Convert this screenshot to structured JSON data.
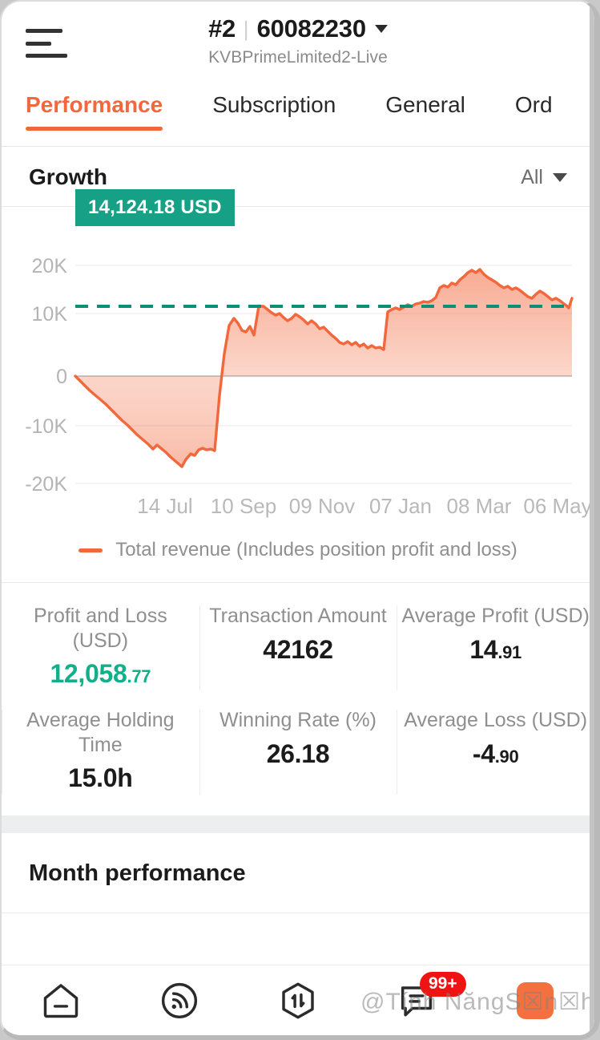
{
  "header": {
    "menu_icon": "hamburger-menu-icon",
    "account_number": "#2",
    "account_separator": "|",
    "account_id": "60082230",
    "dropdown_icon": "chevron-down-icon",
    "server_name": "KVBPrimeLimited2-Live"
  },
  "tabs": [
    {
      "label": "Performance",
      "active": true
    },
    {
      "label": "Subscription",
      "active": false
    },
    {
      "label": "General",
      "active": false
    },
    {
      "label": "Ord",
      "active": false
    }
  ],
  "growth": {
    "title": "Growth",
    "range_label": "All",
    "range_caret_icon": "caret-down-icon",
    "badge_value": "14,124.18 USD",
    "legend_label": "Total revenue (Includes position profit and loss)",
    "line_color": "#f2683c",
    "marker_color": "#16a085"
  },
  "chart_data": {
    "type": "area",
    "title": "Growth",
    "xlabel": "",
    "ylabel": "",
    "ylim": [
      -24000,
      22000
    ],
    "ytick_labels": [
      "20K",
      "10K",
      "0",
      "-10K",
      "-20K"
    ],
    "ytick_values": [
      20000,
      10000,
      0,
      -10000,
      -20000
    ],
    "xtick_labels": [
      "14 Jul",
      "10 Sep",
      "09 Nov",
      "07 Jan",
      "08 Mar",
      "06 May"
    ],
    "grid": true,
    "legend_position": "bottom",
    "annotations": [
      {
        "label": "14,124.18 USD",
        "value": 14124.18,
        "type": "horizontal-dashed-line",
        "color": "#16a085"
      }
    ],
    "series": [
      {
        "name": "Total revenue (Includes position profit and loss)",
        "color": "#f2683c",
        "fill": "gradient",
        "values": [
          0,
          -900,
          -1800,
          -2500,
          -3200,
          -3600,
          -4300,
          -5200,
          -6100,
          -7000,
          -7900,
          -8700,
          -9500,
          -10400,
          -11300,
          -12100,
          -11400,
          -11900,
          -12600,
          -13400,
          -14300,
          -15200,
          -13900,
          -12800,
          -13100,
          -12000,
          -11800,
          -12100,
          -11900,
          -12200,
          -4000,
          4000,
          9200,
          10500,
          9600,
          8300,
          8000,
          9100,
          7400,
          13800,
          13900,
          13300,
          12700,
          12300,
          12600,
          11800,
          11200,
          11600,
          12400,
          11900,
          11300,
          10700,
          11300,
          10600,
          9800,
          10100,
          9300,
          8600,
          7900,
          7200,
          6900,
          7400,
          6800,
          7200,
          6600,
          6900,
          6300,
          6700,
          6200,
          6400,
          5900,
          12200,
          12600,
          12900,
          12700,
          13100,
          13400,
          13200,
          13600,
          13800,
          14100,
          13900,
          14300,
          14800,
          16700,
          17200,
          16900,
          17600,
          17300,
          18200,
          18900,
          19600,
          20100,
          19700,
          20200,
          19400,
          18700,
          18300,
          17900,
          17200,
          16800,
          17100,
          16500,
          16800,
          16300,
          15700,
          15200,
          14900,
          15600,
          16200,
          15800,
          15100,
          14600,
          14900,
          14400,
          13900,
          13600,
          13200,
          12900,
          13300,
          13700,
          14000,
          13800,
          14100,
          13900,
          13700,
          14000,
          13800,
          13500,
          13200,
          12900,
          12600,
          13400,
          14124
        ]
      }
    ]
  },
  "stats": [
    {
      "label": "Profit and Loss (USD)",
      "int": "12,058",
      "dec": ".77",
      "positive": true
    },
    {
      "label": "Transaction Amount",
      "int": "42162",
      "dec": "",
      "positive": false
    },
    {
      "label": "Average Profit (USD)",
      "int": "14",
      "dec": ".91",
      "positive": false
    },
    {
      "label": "Average Holding Time",
      "int": "15.0h",
      "dec": "",
      "positive": false
    },
    {
      "label": "Winning Rate (%)",
      "int": "26.18",
      "dec": "",
      "positive": false
    },
    {
      "label": "Average Loss (USD)",
      "int": "-4",
      "dec": ".90",
      "positive": false
    }
  ],
  "month_performance": {
    "title": "Month performance"
  },
  "bottom_nav": [
    {
      "name": "home-icon",
      "badge": ""
    },
    {
      "name": "signal-icon",
      "badge": ""
    },
    {
      "name": "trade-icon",
      "badge": ""
    },
    {
      "name": "chat-icon",
      "badge": "99+"
    },
    {
      "name": "app-icon",
      "badge": ""
    }
  ],
  "watermark": {
    "text": "@Tính NăngS☒n☒h☒m"
  },
  "colors": {
    "accent_orange": "#f2683c",
    "accent_green": "#11b08a",
    "badge_teal": "#16a085",
    "badge_red": "#ef1414"
  }
}
